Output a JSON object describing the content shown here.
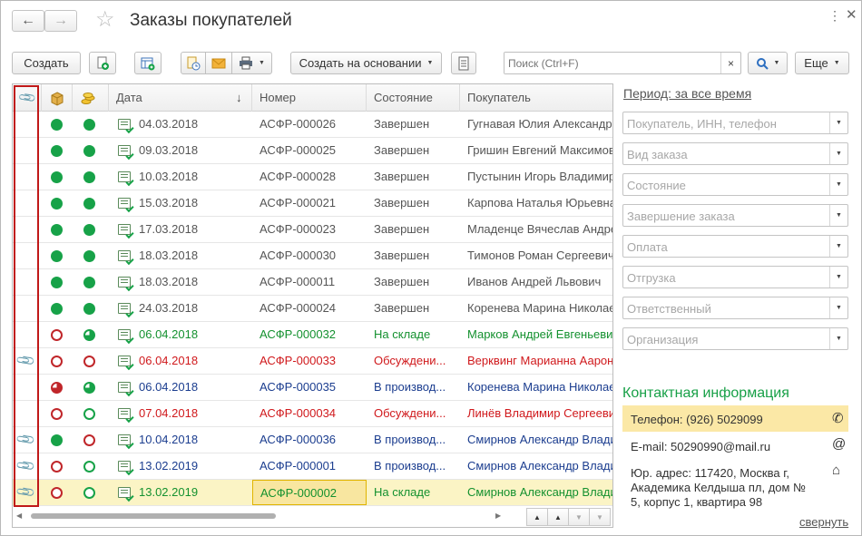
{
  "window": {
    "title": "Заказы покупателей"
  },
  "toolbar": {
    "create_label": "Создать",
    "create_based_on_label": "Создать на основании",
    "more_label": "Еще",
    "search_placeholder": "Поиск (Ctrl+F)",
    "search_clear": "×"
  },
  "table": {
    "headers": {
      "date": "Дата",
      "number": "Номер",
      "state": "Состояние",
      "customer": "Покупатель",
      "sort": "↓"
    },
    "rows": [
      {
        "clip": false,
        "s1": "green",
        "s2": "green",
        "color": "gray",
        "date": "04.03.2018",
        "number": "АСФР-000026",
        "state": "Завершен",
        "customer": "Гугнавая Юлия Александро"
      },
      {
        "clip": false,
        "s1": "green",
        "s2": "green",
        "color": "gray",
        "date": "09.03.2018",
        "number": "АСФР-000025",
        "state": "Завершен",
        "customer": "Гришин Евгений Максимов"
      },
      {
        "clip": false,
        "s1": "green",
        "s2": "green",
        "color": "gray",
        "date": "10.03.2018",
        "number": "АСФР-000028",
        "state": "Завершен",
        "customer": "Пустынин Игорь Владимир"
      },
      {
        "clip": false,
        "s1": "green",
        "s2": "green",
        "color": "gray",
        "date": "15.03.2018",
        "number": "АСФР-000021",
        "state": "Завершен",
        "customer": "Карпова Наталья Юрьевна"
      },
      {
        "clip": false,
        "s1": "green",
        "s2": "green",
        "color": "gray",
        "date": "17.03.2018",
        "number": "АСФР-000023",
        "state": "Завершен",
        "customer": "Младенце Вячеслав Андре"
      },
      {
        "clip": false,
        "s1": "green",
        "s2": "green",
        "color": "gray",
        "date": "18.03.2018",
        "number": "АСФР-000030",
        "state": "Завершен",
        "customer": "Тимонов Роман Сергеевич"
      },
      {
        "clip": false,
        "s1": "green",
        "s2": "green",
        "color": "gray",
        "date": "18.03.2018",
        "number": "АСФР-000011",
        "state": "Завершен",
        "customer": "Иванов Андрей Львович"
      },
      {
        "clip": false,
        "s1": "green",
        "s2": "green",
        "color": "gray",
        "date": "24.03.2018",
        "number": "АСФР-000024",
        "state": "Завершен",
        "customer": "Коренева Марина Николае"
      },
      {
        "clip": false,
        "s1": "red-ring",
        "s2": "green-part",
        "color": "green",
        "date": "06.04.2018",
        "number": "АСФР-000032",
        "state": "На складе",
        "customer": "Марков Андрей Евгеньеви"
      },
      {
        "clip": true,
        "s1": "red-ring",
        "s2": "red-ring",
        "color": "red",
        "date": "06.04.2018",
        "number": "АСФР-000033",
        "state": "Обсуждени...",
        "customer": "Верквинг Марианна Аарон"
      },
      {
        "clip": false,
        "s1": "red-part",
        "s2": "green-part",
        "color": "blue",
        "date": "06.04.2018",
        "number": "АСФР-000035",
        "state": "В производ...",
        "customer": "Коренева Марина Николае"
      },
      {
        "clip": false,
        "s1": "red-ring",
        "s2": "green-ring",
        "color": "red",
        "date": "07.04.2018",
        "number": "АСФР-000034",
        "state": "Обсуждени...",
        "customer": "Линёв Владимир Сергееви"
      },
      {
        "clip": true,
        "s1": "green",
        "s2": "red-ring",
        "color": "blue",
        "date": "10.04.2018",
        "number": "АСФР-000036",
        "state": "В производ...",
        "customer": "Смирнов Александр Влади"
      },
      {
        "clip": true,
        "s1": "red-ring",
        "s2": "green-ring",
        "color": "blue",
        "date": "13.02.2019",
        "number": "АСФР-000001",
        "state": "В производ...",
        "customer": "Смирнов Александр Влади"
      },
      {
        "clip": true,
        "s1": "red-ring",
        "s2": "green-ring",
        "color": "green",
        "date": "13.02.2019",
        "number": "АСФР-000002",
        "state": "На складе",
        "customer": "Смирнов Александр Влади",
        "selected": true
      }
    ]
  },
  "filters": {
    "period_label": "Период: за все время",
    "items": [
      "Покупатель, ИНН, телефон",
      "Вид заказа",
      "Состояние",
      "Завершение заказа",
      "Оплата",
      "Отгрузка",
      "Ответственный",
      "Организация"
    ]
  },
  "contact": {
    "title": "Контактная информация",
    "phone": "Телефон: (926) 5029099",
    "email": "E-mail: 50290990@mail.ru",
    "address_1": "Юр. адрес: 117420, Москва г,",
    "address_2": "Академика Келдыша пл, дом №",
    "address_3": "5, корпус 1, квартира 98",
    "collapse_label": "свернуть"
  },
  "colors": {
    "green": "#17a248",
    "red": "#c0262a",
    "blue": "#1b3d8f",
    "accent_yellow": "#fbe8a6"
  }
}
